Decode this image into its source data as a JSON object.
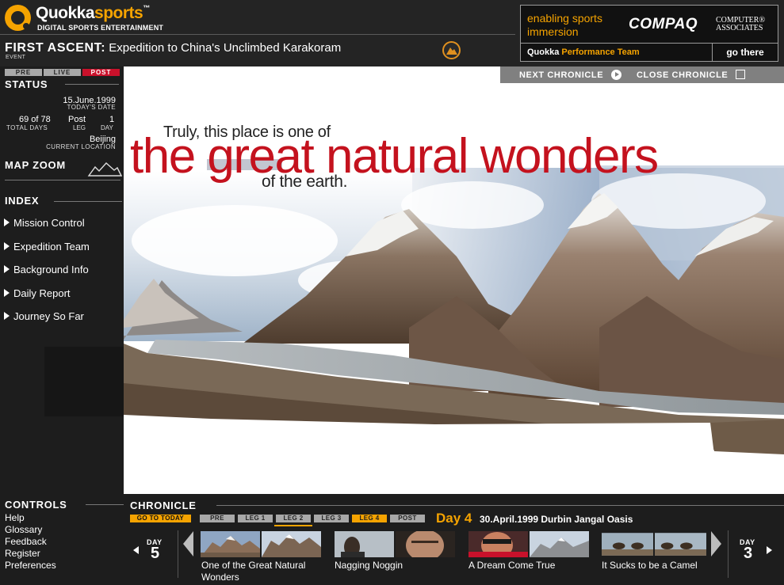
{
  "brand": {
    "name_a": "Quokka",
    "name_b": "sports",
    "tm": "™",
    "tagline": "DIGITAL SPORTS ENTERTAINMENT"
  },
  "event": {
    "title_bold": "FIRST ASCENT:",
    "title_rest": "Expedition to China's Unclimbed Karakoram",
    "label": "EVENT"
  },
  "sponsor": {
    "enabling": "enabling sports immersion",
    "compaq": "COMPAQ",
    "ca_line1": "COMPUTER®",
    "ca_line2": "ASSOCIATES",
    "team_a": "Quokka",
    "team_b": "Performance Team",
    "go": "go there"
  },
  "phases": [
    "PRE",
    "LIVE",
    "POST"
  ],
  "status": {
    "heading": "STATUS",
    "date": "15.June.1999",
    "date_label": "TODAY'S DATE",
    "days": "69 of 78",
    "days_label": "TOTAL DAYS",
    "leg": "Post",
    "leg_label": "LEG",
    "day": "1",
    "day_label": "DAY",
    "location": "Beijing",
    "location_label": "CURRENT LOCATION"
  },
  "map_zoom": "MAP ZOOM",
  "index": {
    "heading": "INDEX",
    "items": [
      "Mission Control",
      "Expedition Team",
      "Background Info",
      "Daily Report",
      "Journey So Far"
    ]
  },
  "controls": {
    "heading": "CONTROLS",
    "items": [
      "Help",
      "Glossary",
      "Feedback",
      "Register",
      "Preferences"
    ]
  },
  "topbar": {
    "next": "NEXT CHRONICLE",
    "close": "CLOSE CHRONICLE"
  },
  "caption": {
    "pre": "Truly, this place is one of",
    "main": "the great natural wonders",
    "post": "of the earth."
  },
  "chronicle": {
    "heading": "CHRONICLE",
    "go_today": "GO TO TODAY",
    "legs": [
      "PRE",
      "LEG 1",
      "LEG 2",
      "LEG 3",
      "LEG 4",
      "POST"
    ],
    "day_title": "Day 4",
    "day_meta": "30.April.1999  Durbin Jangal Oasis",
    "prev_label": "DAY",
    "prev_num": "5",
    "next_label": "DAY",
    "next_num": "3",
    "stories": [
      {
        "title": "One of the Great Natural Wonders"
      },
      {
        "title": "Nagging Noggin"
      },
      {
        "title": "A Dream Come True"
      },
      {
        "title": "It Sucks to be a Camel"
      }
    ]
  },
  "colors": {
    "accent": "#f5a300",
    "red": "#c4121e",
    "post_tab": "#c9112b"
  }
}
